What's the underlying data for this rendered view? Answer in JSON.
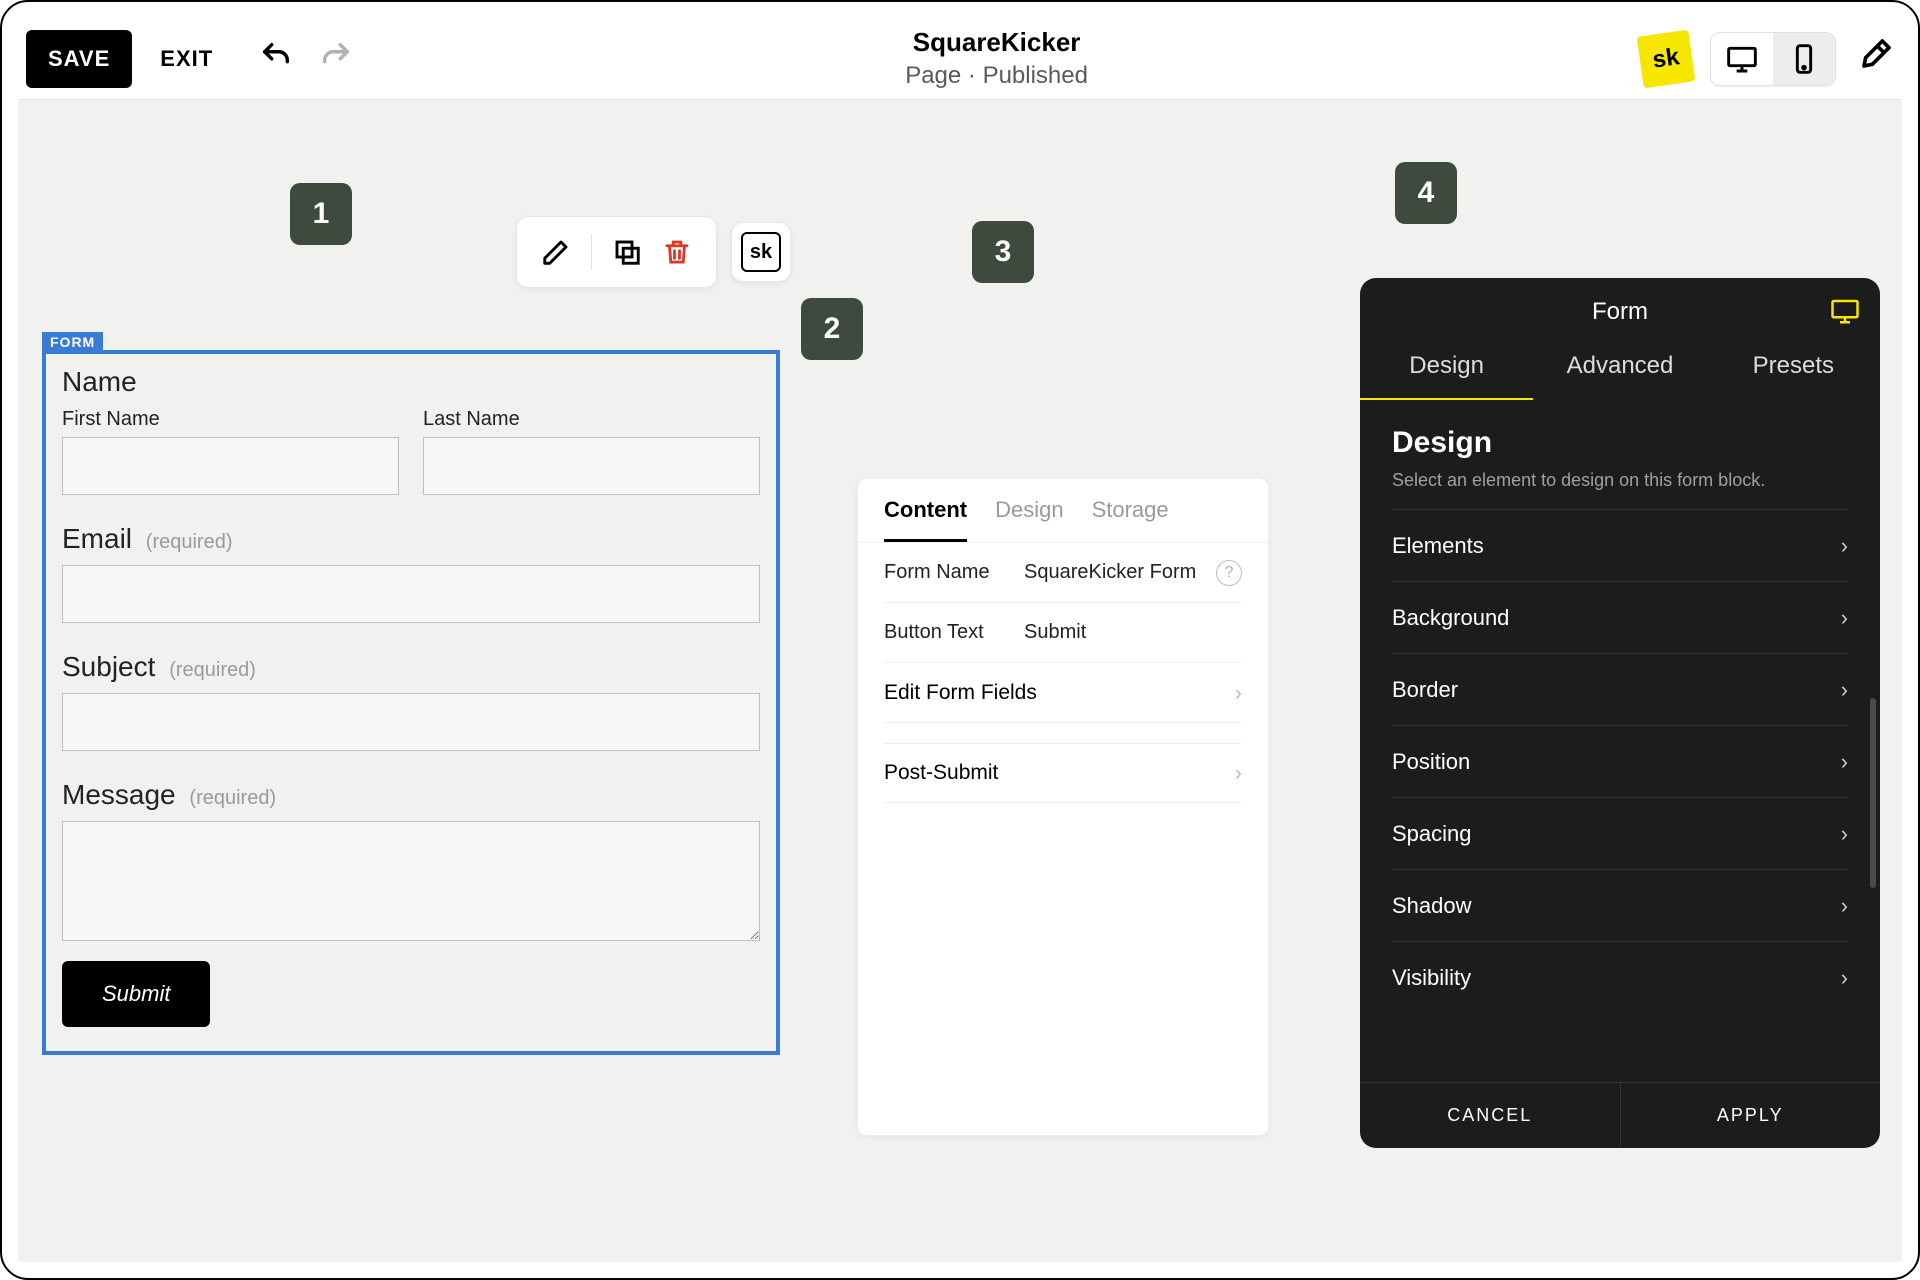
{
  "topbar": {
    "save": "SAVE",
    "exit": "EXIT",
    "title": "SquareKicker",
    "subtitle": "Page · Published"
  },
  "steps": {
    "s1": "1",
    "s2": "2",
    "s3": "3",
    "s4": "4"
  },
  "form": {
    "tag": "FORM",
    "name_label": "Name",
    "first_name": "First Name",
    "last_name": "Last Name",
    "email_label": "Email",
    "subject_label": "Subject",
    "message_label": "Message",
    "required": "(required)",
    "submit": "Submit"
  },
  "mid": {
    "tabs": {
      "content": "Content",
      "design": "Design",
      "storage": "Storage"
    },
    "form_name_label": "Form Name",
    "form_name_value": "SquareKicker Form",
    "button_text_label": "Button Text",
    "button_text_value": "Submit",
    "edit_fields": "Edit Form Fields",
    "post_submit": "Post-Submit"
  },
  "right": {
    "title": "Form",
    "tabs": {
      "design": "Design",
      "advanced": "Advanced",
      "presets": "Presets"
    },
    "heading": "Design",
    "sub": "Select an element to design on this form block.",
    "items": [
      "Elements",
      "Background",
      "Border",
      "Position",
      "Spacing",
      "Shadow",
      "Visibility"
    ],
    "cancel": "CANCEL",
    "apply": "APPLY"
  },
  "sk_text": "sk",
  "help_glyph": "?"
}
